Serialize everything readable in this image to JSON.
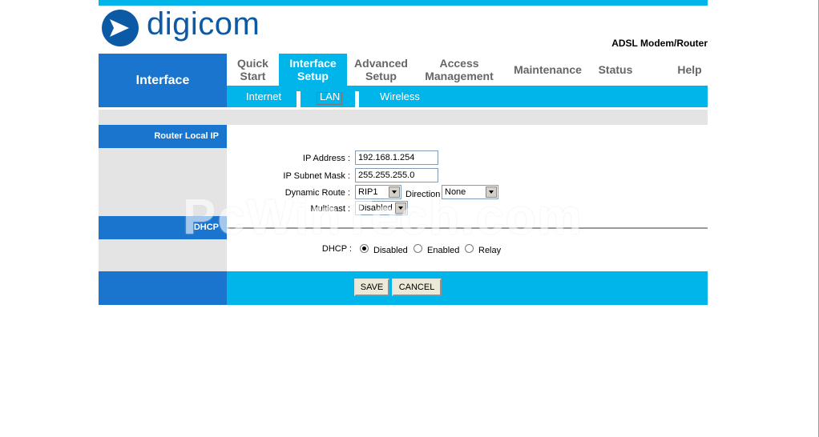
{
  "brand": {
    "logo_text": "digicom",
    "product": "ADSL Modem/Router"
  },
  "header": {
    "section_title": "Interface"
  },
  "tabs": [
    {
      "label_line1": "Quick",
      "label_line2": "Start"
    },
    {
      "label_line1": "Interface",
      "label_line2": "Setup"
    },
    {
      "label_line1": "Advanced",
      "label_line2": "Setup"
    },
    {
      "label_line1": "Access",
      "label_line2": "Management"
    },
    {
      "label_line1": "Maintenance",
      "label_line2": ""
    },
    {
      "label_line1": "Status",
      "label_line2": ""
    },
    {
      "label_line1": "Help",
      "label_line2": ""
    }
  ],
  "subnav": {
    "internet": "Internet",
    "lan": "LAN",
    "wireless": "Wireless"
  },
  "router_local_ip": {
    "heading": "Router Local IP",
    "ip_label": "IP Address :",
    "ip_value": "192.168.1.254",
    "mask_label": "IP Subnet Mask :",
    "mask_value": "255.255.255.0",
    "route_label": "Dynamic Route :",
    "route_value": "RIP1",
    "direction_label": "Direction",
    "direction_value": "None",
    "multicast_label": "Multicast :",
    "multicast_value": "Disabled"
  },
  "dhcp": {
    "heading": "DHCP",
    "label": "DHCP :",
    "options": [
      "Disabled",
      "Enabled",
      "Relay"
    ],
    "selected": "Disabled"
  },
  "buttons": {
    "save": "SAVE",
    "cancel": "CANCEL"
  },
  "watermark": "PcWinTech.com",
  "colors": {
    "primary_blue": "#1a75cf",
    "accent_cyan": "#00b5ea",
    "panel_gray": "#e4e4e4"
  }
}
